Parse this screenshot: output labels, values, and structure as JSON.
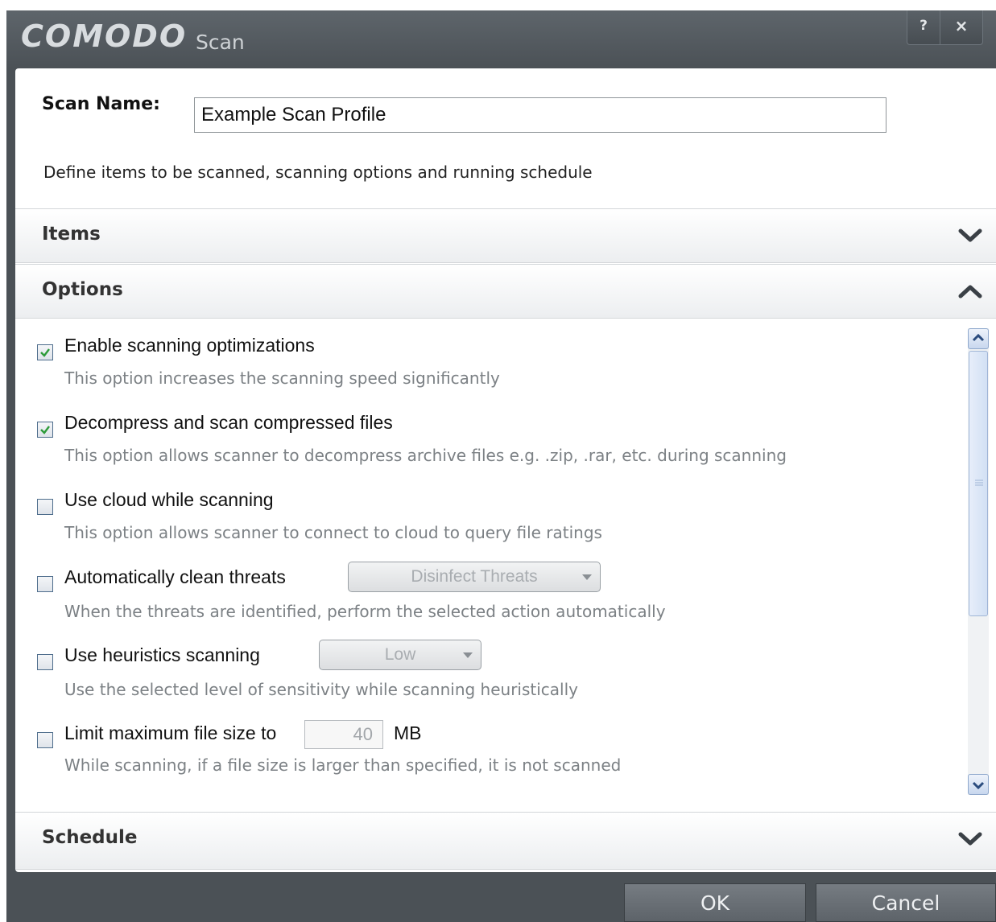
{
  "window": {
    "brand": "COMODO",
    "title": "Scan",
    "help_label": "?",
    "close_label": "×"
  },
  "scan_name": {
    "label": "Scan Name:",
    "value": "Example Scan Profile"
  },
  "intro": "Define items to be scanned, scanning options and running schedule",
  "sections": {
    "items": {
      "label": "Items",
      "state": "collapsed"
    },
    "options": {
      "label": "Options",
      "state": "expanded"
    },
    "schedule": {
      "label": "Schedule",
      "state": "collapsed"
    }
  },
  "options": [
    {
      "label": "Enable scanning optimizations",
      "description": "This option increases the scanning speed significantly",
      "checked": true
    },
    {
      "label": "Decompress and scan compressed files",
      "description": "This option allows scanner to decompress archive files e.g. .zip, .rar, etc. during scanning",
      "checked": true
    },
    {
      "label": "Use cloud while scanning",
      "description": "This option allows scanner to connect to cloud to query file ratings",
      "checked": false
    },
    {
      "label": "Automatically clean threats",
      "description": "When the threats are identified, perform the selected action automatically",
      "checked": false,
      "dropdown": "Disinfect Threats"
    },
    {
      "label": "Use heuristics scanning",
      "description": "Use the selected level of sensitivity while scanning heuristically",
      "checked": false,
      "dropdown": "Low"
    },
    {
      "label": "Limit maximum file size to",
      "description": "While scanning, if a file size is larger than specified, it is not scanned",
      "checked": false,
      "value": "40",
      "unit": "MB"
    }
  ],
  "footer": {
    "ok_label": "OK",
    "cancel_label": "Cancel"
  },
  "colors": {
    "titlebar": "#4b5156",
    "checkmark": "#2e9b3a",
    "chevron": "#3a4046"
  },
  "icons": {
    "collapsed": "chevron-down-icon",
    "expanded": "chevron-up-icon"
  }
}
